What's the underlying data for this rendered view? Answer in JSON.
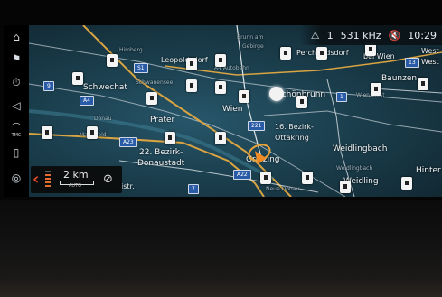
{
  "status_bar": {
    "warning_icon": "warning-triangle-icon",
    "warning_count": "1",
    "radio_frequency": "531 kHz",
    "mute_icon": "speaker-muted-icon",
    "time": "10:29"
  },
  "sidebar": {
    "items": [
      {
        "icon": "home-icon",
        "label": ""
      },
      {
        "icon": "destination-flag-icon",
        "label": ""
      },
      {
        "icon": "timer-icon",
        "label": ""
      },
      {
        "icon": "volume-icon",
        "label": ""
      },
      {
        "icon": "tmc-traffic-icon",
        "label": "TMC"
      },
      {
        "icon": "map-icon",
        "label": ""
      },
      {
        "icon": "compass-icon",
        "label": ""
      }
    ]
  },
  "scale_widget": {
    "distance": "2 km",
    "mode": "AUTO"
  },
  "map_labels": {
    "brunn": "Brunn am",
    "gebirge": "Gebirge",
    "perchtoldsdorf": "Perchtoldsdorf",
    "leopoldsdorf": "Leopoldsdorf",
    "himberg": "Himberg",
    "bei_wien": "bei Wien",
    "west1": "West",
    "west2": "West",
    "schwechat": "Schwechat",
    "schwanenstadt": "Schwanensee",
    "autobahn": "A4 Autobahn",
    "baunzen": "Baunzen",
    "schoenbrunn": "Schönbrunn",
    "wien_west": "Wien West",
    "wien": "Wien",
    "prater": "Prater",
    "donau": "Donau",
    "bezirk16a": "16. Bezirk-",
    "bezirk16b": "Ottakring",
    "marchfeld": "Marchfeld",
    "weidlingbach": "Weidlingbach",
    "bezirk22a": "22. Bezirk-",
    "bezirk22b": "Donaustadt",
    "grinzing": "Grinzing",
    "weidlingbach2": "Weidlingbach",
    "hinter": "Hinter",
    "weidling": "Weidling",
    "neudonau": "Neue Donau",
    "istr": "istr."
  },
  "road_shields": {
    "s1": "S1",
    "a9": "9",
    "a4": "A4",
    "r221": "221",
    "a23": "A23",
    "a22": "A22",
    "r7": "7",
    "r1": "1",
    "r13": "13"
  },
  "colors": {
    "map_water": "#1c4150",
    "road_major": "#d9a441",
    "road_minor": "#c9d3da",
    "car_marker": "#f08a24",
    "scale_accent": "#e34b2b"
  }
}
